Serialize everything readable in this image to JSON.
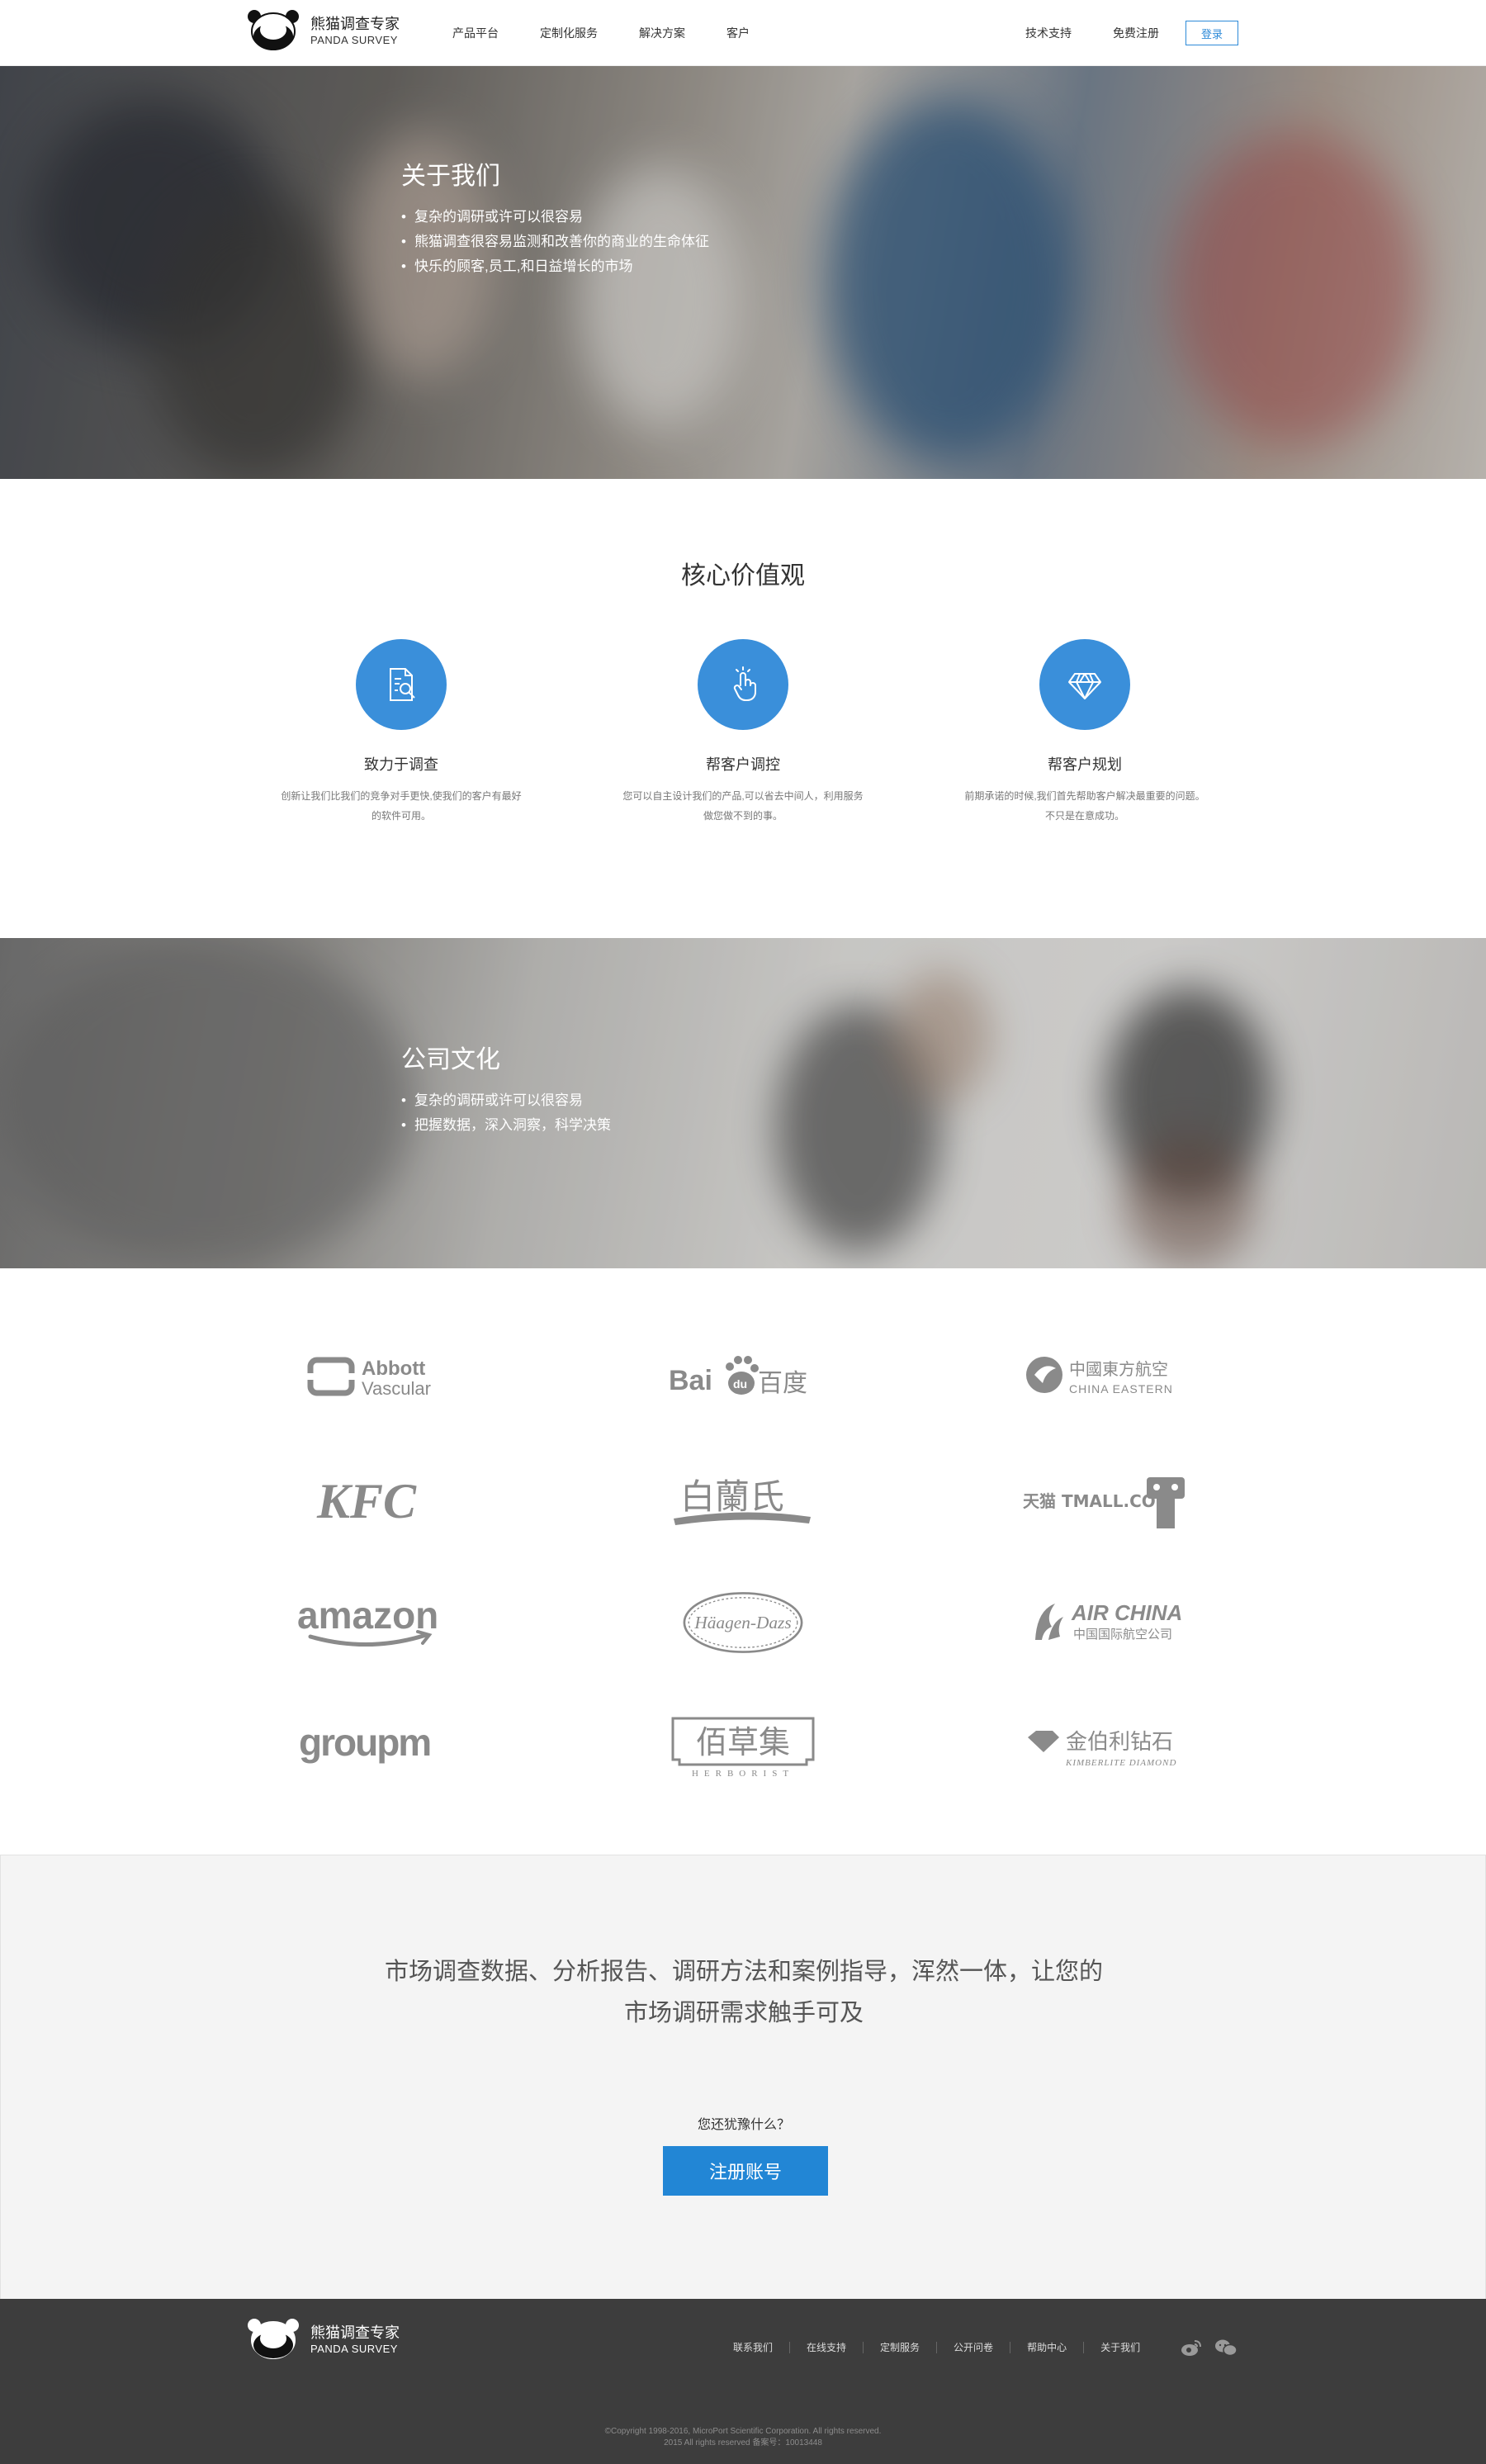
{
  "brand": {
    "name": "熊猫调查专家",
    "sub": "PANDA SURVEY"
  },
  "nav": {
    "items": [
      "产品平台",
      "定制化服务",
      "解决方案",
      "客户"
    ],
    "right_items": [
      "技术支持",
      "免费注册"
    ],
    "login": "登录"
  },
  "about": {
    "title": "关于我们",
    "points": [
      "复杂的调研或许可以很容易",
      "熊猫调查很容易监测和改善你的商业的生命体征",
      "快乐的顾客,员工,和日益增长的市场"
    ]
  },
  "values": {
    "title": "核心价值观",
    "items": [
      {
        "icon": "document-search-icon",
        "name": "致力于调查",
        "desc": "创新让我们比我们的竞争对手更快,使我们的客户有最好的软件可用。"
      },
      {
        "icon": "touch-hand-icon",
        "name": "帮客户调控",
        "desc": "您可以自主设计我们的产品,可以省去中间人，利用服务做您做不到的事。"
      },
      {
        "icon": "diamond-icon",
        "name": "帮客户规划",
        "desc": "前期承诺的时候,我们首先帮助客户解决最重要的问题。不只是在意成功。"
      }
    ]
  },
  "culture": {
    "title": "公司文化",
    "points": [
      "复杂的调研或许可以很容易",
      "把握数据，深入洞察，科学决策"
    ]
  },
  "clients": {
    "logos": [
      {
        "brand": "Abbott Vascular",
        "line1": "Abbott",
        "line2": "Vascular"
      },
      {
        "brand": "Baidu",
        "line1": "Bai",
        "line2": "百度"
      },
      {
        "brand": "China Eastern",
        "line1": "中國東方航空",
        "line2": "CHINA EASTERN"
      },
      {
        "brand": "KFC",
        "line1": "KFC",
        "line2": ""
      },
      {
        "brand": "白蘭氏",
        "line1": "白蘭氏",
        "line2": ""
      },
      {
        "brand": "Tmall",
        "line1": "天猫 TMALL.COM",
        "line2": ""
      },
      {
        "brand": "amazon",
        "line1": "amazon",
        "line2": ""
      },
      {
        "brand": "Häagen-Dazs",
        "line1": "Häagen-Dazs",
        "line2": ""
      },
      {
        "brand": "Air China",
        "line1": "AIR CHINA",
        "line2": "中国国际航空公司"
      },
      {
        "brand": "groupm",
        "line1": "groupm",
        "line2": ""
      },
      {
        "brand": "佰草集",
        "line1": "佰草集",
        "line2": "HERBORIST"
      },
      {
        "brand": "金伯利钻石",
        "line1": "金伯利钻石",
        "line2": "KIMBERLITE DIAMOND"
      }
    ]
  },
  "cta": {
    "line1": "市场调查数据、分析报告、调研方法和案例指导，浑然一体，让您的",
    "line2": "市场调研需求触手可及",
    "question": "您还犹豫什么？",
    "button": "注册账号"
  },
  "footer": {
    "links": [
      "联系我们",
      "在线支持",
      "定制服务",
      "公开问卷",
      "帮助中心",
      "关于我们"
    ],
    "social": [
      "weibo-icon",
      "wechat-icon"
    ],
    "copyright1": "©Copyright 1998-2016, MicroPort Scientific Corporation. All rights reserved.",
    "copyright2": "2015 All rights reserved 备案号：10013448"
  },
  "colors": {
    "accent": "#2286d5",
    "icon_bg": "#3a8fda",
    "footer_bg": "#3d3d3d",
    "cta_bg": "#f4f4f4"
  }
}
